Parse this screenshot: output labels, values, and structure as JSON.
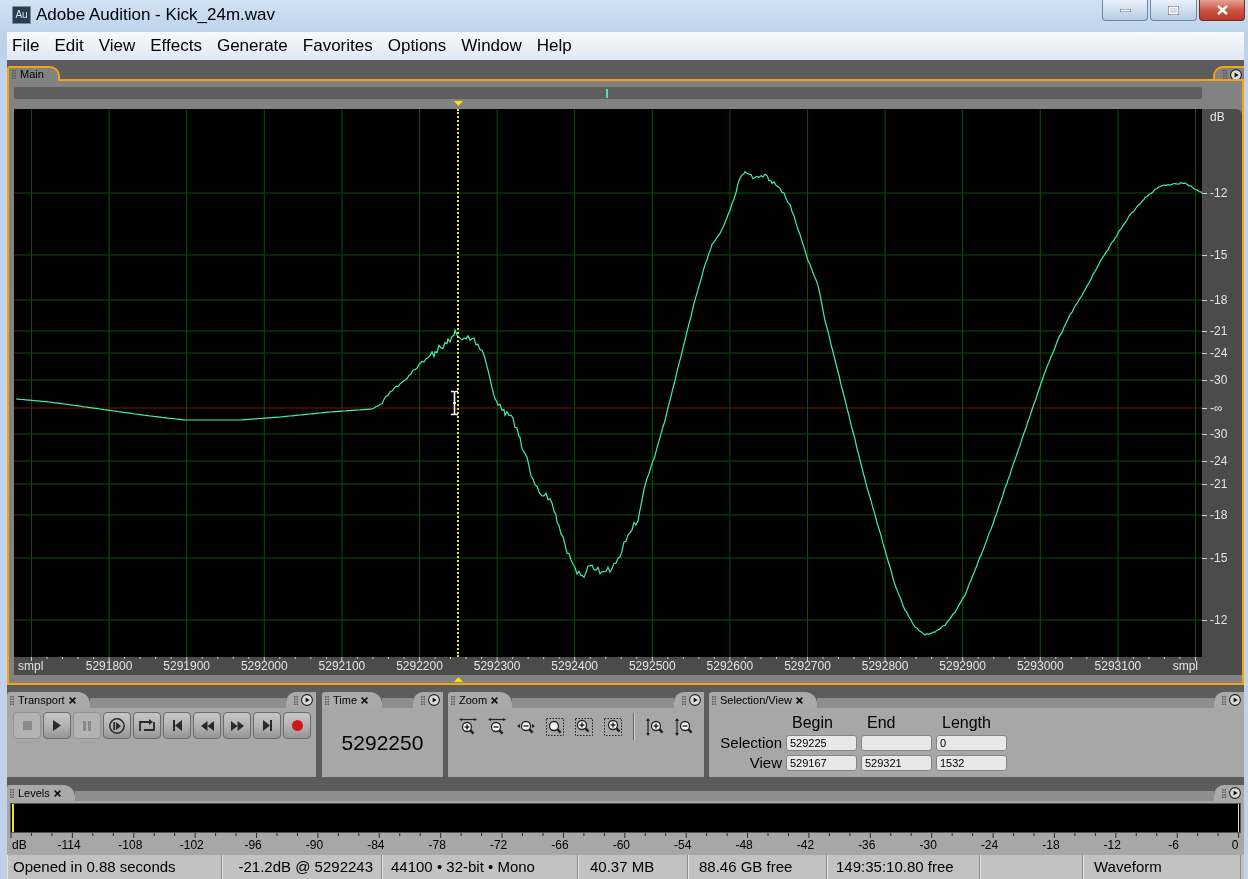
{
  "window": {
    "title": "Adobe Audition - Kick_24m.wav",
    "app_icon": "Au"
  },
  "menu": [
    {
      "label": "File"
    },
    {
      "label": "Edit"
    },
    {
      "label": "View"
    },
    {
      "label": "Effects"
    },
    {
      "label": "Generate"
    },
    {
      "label": "Favorites"
    },
    {
      "label": "Options"
    },
    {
      "label": "Window"
    },
    {
      "label": "Help"
    }
  ],
  "main": {
    "tab": {
      "label": "Main",
      "selected": true
    },
    "playhead": {
      "level": 0.374
    },
    "sample_ruler": {
      "unit_left": "smpl",
      "labels": [
        "5291800",
        "5291900",
        "5292000",
        "5292100",
        "5292200",
        "5292300",
        "5292400",
        "5292500",
        "5292600",
        "5292700",
        "5292800",
        "5292900",
        "5293000",
        "5293100"
      ],
      "unit_right": "smpl"
    },
    "db_ruler": {
      "unit": "dB",
      "labels": [
        "-12",
        "-15",
        "-18",
        "-21",
        "-24",
        "-30",
        "-∞",
        "-30",
        "-24",
        "-21",
        "-18",
        "-15",
        "-12"
      ]
    }
  },
  "transport": {
    "tab": {
      "label": "Transport",
      "selected": false
    },
    "buttons": [
      {
        "kind": "stop",
        "disabled": true
      },
      {
        "kind": "play",
        "disabled": false
      },
      {
        "kind": "pause",
        "disabled": true
      },
      {
        "kind": "playtoend",
        "disabled": false
      },
      {
        "kind": "loop",
        "disabled": false
      },
      {
        "kind": "start",
        "disabled": false
      },
      {
        "kind": "rewind",
        "disabled": false
      },
      {
        "kind": "forward",
        "disabled": false
      },
      {
        "kind": "end",
        "disabled": false
      },
      {
        "kind": "record",
        "disabled": false
      }
    ]
  },
  "time": {
    "tab": {
      "label": "Time",
      "selected": false
    },
    "value": "5292250"
  },
  "zoom": {
    "tab": {
      "label": "Zoom",
      "selected": false
    },
    "tools": [
      {
        "kind": "infull"
      },
      {
        "kind": "outfull"
      },
      {
        "kind": "outcenter"
      },
      {
        "kind": "selection"
      },
      {
        "kind": "left"
      },
      {
        "kind": "right"
      },
      {
        "kind": "separator"
      },
      {
        "kind": "vin"
      },
      {
        "kind": "vout"
      }
    ]
  },
  "selection_view": {
    "tab": {
      "label": "Selection/View",
      "selected": false
    },
    "columns": [
      "Begin",
      "End",
      "Length"
    ],
    "rows": [
      {
        "label": "Selection",
        "begin": "529225",
        "length": "0"
      },
      {
        "label": "View",
        "begin": "529167",
        "end": "529321",
        "length": "1532"
      }
    ]
  },
  "levels": {
    "tab": {
      "label": "Levels",
      "selected": false
    },
    "scale": [
      "dB",
      "-114",
      "-108",
      "-102",
      "-96",
      "-90",
      "-84",
      "-78",
      "-72",
      "-66",
      "-60",
      "-54",
      "-48",
      "-42",
      "-36",
      "-30",
      "-24",
      "-18",
      "-12",
      "-6",
      "0"
    ]
  },
  "status_bar": [
    "Opened in 0.88 seconds",
    "-21.2dB @ 5292243",
    "44100 • 32-bit • Mono",
    "40.37 MB",
    "88.46 GB free",
    "149:35:10.80 free",
    "Waveform"
  ]
}
